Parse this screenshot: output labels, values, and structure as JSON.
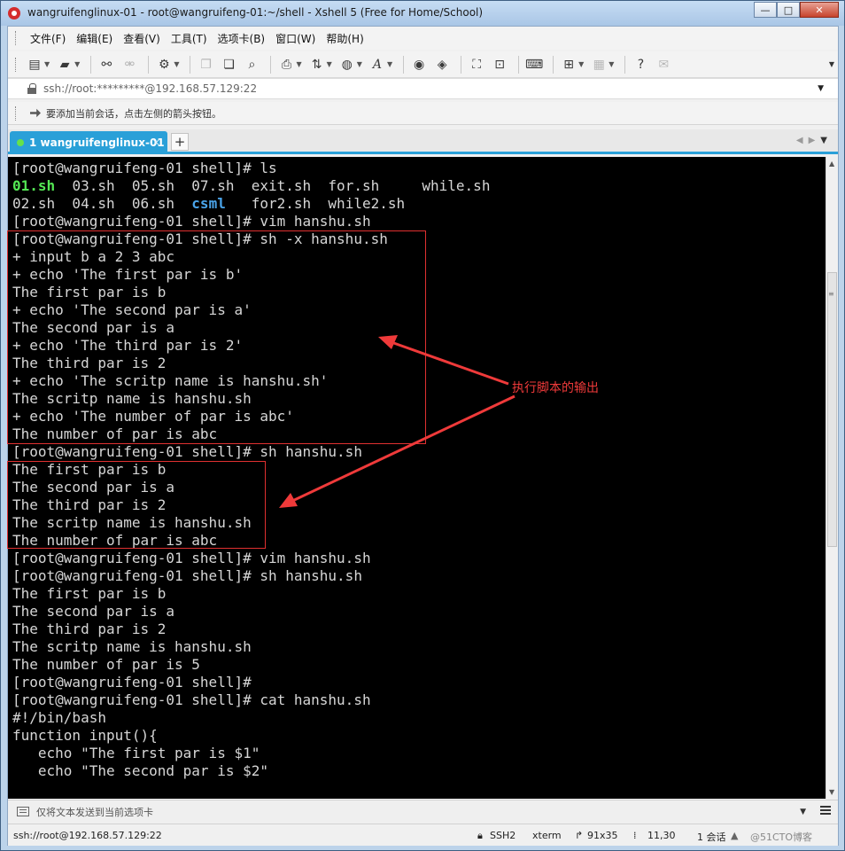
{
  "window": {
    "title": "wangruifenglinux-01 - root@wangruifeng-01:~/shell - Xshell 5 (Free for Home/School)",
    "controls": {
      "minimize": "—",
      "maximize": "□",
      "close": "✕"
    }
  },
  "menu": [
    "文件(F)",
    "编辑(E)",
    "查看(V)",
    "工具(T)",
    "选项卡(B)",
    "窗口(W)",
    "帮助(H)"
  ],
  "toolbar_icons": [
    "new-session-icon",
    "open-folder-icon",
    "reconnect-icon",
    "disconnect-icon",
    "properties-icon",
    "copy-icon",
    "paste-icon",
    "find-icon",
    "print-icon",
    "transfer-icon",
    "globe-icon",
    "font-icon",
    "xftp-icon",
    "xmanager-icon",
    "fullscreen-icon",
    "lock-icon",
    "keyboard-icon",
    "compose-icon",
    "layout-icon",
    "help-icon",
    "chat-icon"
  ],
  "address": {
    "text": "ssh://root:*********@192.168.57.129:22"
  },
  "hint": {
    "text": "要添加当前会话，点击左侧的箭头按钮。"
  },
  "tab": {
    "label": "1 wangruifenglinux-01",
    "close": "×",
    "add": "+"
  },
  "terminal": {
    "lines": [
      "[root@wangruifeng-01 shell]# ls",
      "",
      "02.sh  04.sh  06.sh  ",
      "[root@wangruifeng-01 shell]# vim hanshu.sh",
      "[root@wangruifeng-01 shell]# sh -x hanshu.sh",
      "+ input b a 2 3 abc",
      "+ echo 'The first par is b'",
      "The first par is b",
      "+ echo 'The second par is a'",
      "The second par is a",
      "+ echo 'The third par is 2'",
      "The third par is 2",
      "+ echo 'The scritp name is hanshu.sh'",
      "The scritp name is hanshu.sh",
      "+ echo 'The number of par is abc'",
      "The number of par is abc",
      "[root@wangruifeng-01 shell]# sh hanshu.sh",
      "The first par is b",
      "The second par is a",
      "The third par is 2",
      "The scritp name is hanshu.sh",
      "The number of par is abc",
      "[root@wangruifeng-01 shell]# vim hanshu.sh",
      "[root@wangruifeng-01 shell]# sh hanshu.sh",
      "The first par is b",
      "The second par is a",
      "The third par is 2",
      "The scritp name is hanshu.sh",
      "The number of par is 5",
      "[root@wangruifeng-01 shell]# ",
      "[root@wangruifeng-01 shell]# cat hanshu.sh",
      "#!/bin/bash",
      "function input(){",
      "   echo \"The first par is $1\"",
      "   echo \"The second par is $2\""
    ],
    "ls_row1": {
      "green": "01.sh",
      "rest": "  03.sh  05.sh  07.sh  exit.sh  for.sh     while.sh"
    },
    "ls_row2": {
      "blue": "csml",
      "rest": "   for2.sh  while2.sh"
    },
    "colors": {
      "background": "#000000",
      "text": "#d6d6d6",
      "executable": "#54e854",
      "directory": "#4aa4ea"
    }
  },
  "annotation": {
    "label": "执行脚本的输出",
    "color": "#e03030"
  },
  "sendbar": {
    "text": "仅将文本发送到当前选项卡"
  },
  "status": {
    "address": "ssh://root@192.168.57.129:22",
    "protocol": "SSH2",
    "term": "xterm",
    "size": "91x35",
    "cursor": "11,30",
    "sessions": "1 会话",
    "watermark": "@51CTO博客"
  }
}
